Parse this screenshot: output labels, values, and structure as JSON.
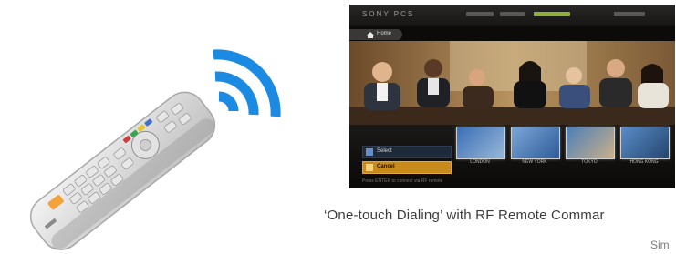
{
  "tv": {
    "logo": "SONY PCS",
    "home_label": "Home",
    "option_select": "Select",
    "option_cancel": "Cancel",
    "hint": "Press ENTER to connect via RF remote",
    "thumbnails": [
      {
        "label": "LONDON"
      },
      {
        "label": "NEW YORK"
      },
      {
        "label": "TOKYO"
      },
      {
        "label": "HONG KONG"
      }
    ]
  },
  "captions": {
    "main": "‘One-touch Dialing’ with RF Remote Commar",
    "sub": "Sim"
  },
  "colors": {
    "signal": "#1b8ae2",
    "cancel_highlight": "#c98a1c",
    "active_menu": "#8fae3a"
  },
  "icons": [
    "signal-waves-icon",
    "home-icon",
    "remote-control-icon"
  ]
}
